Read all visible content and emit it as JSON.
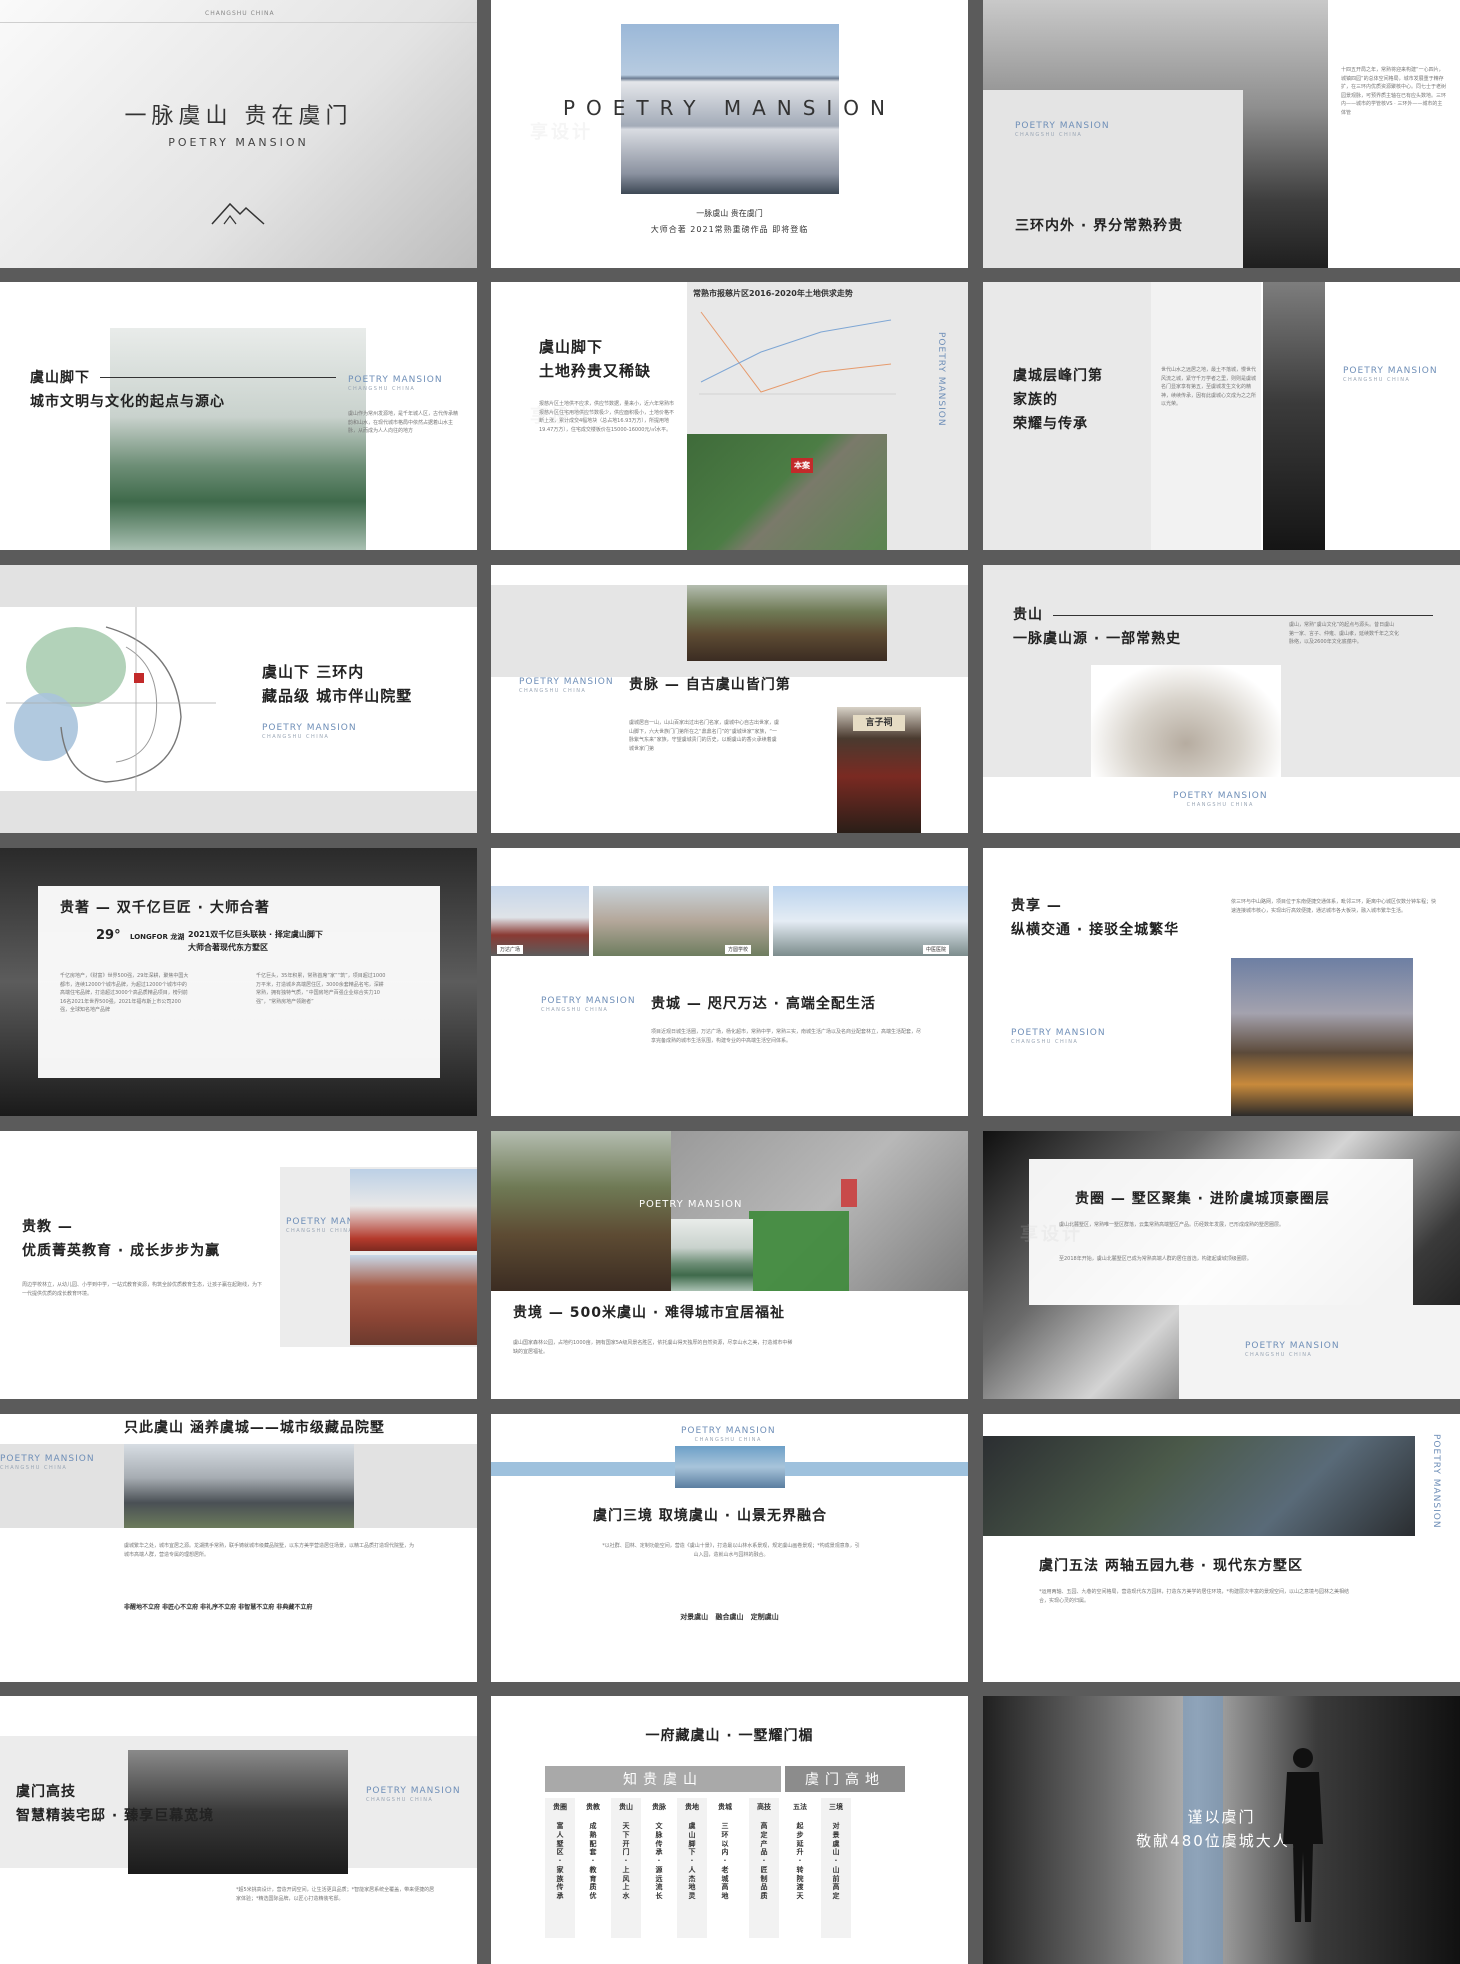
{
  "slides": {
    "s1": {
      "top_label": "CHANGSHU CHINA",
      "title": "一脉虞山 贵在虞门",
      "subtitle": "POETRY MANSION"
    },
    "s2": {
      "overlay": "POETRY MANSION",
      "line1": "一脉虞山 贵在虞门",
      "line2": "大师合著 2021常熟重磅作品 即将登临"
    },
    "s3": {
      "brand": "POETRY MANSION",
      "brand_sub": "CHANGSHU CHINA",
      "title": "三环内外 · 界分常熟矜贵",
      "side_text": "十四五开局之年，常熟将迎来构建“一心四片，城镇四园”的总体空间格局，城市发展重于精存扩，在三环内优质资源聚核中心。同七士于老树园景观脉，可预界质主轴在已有应头数地。三环内——城市的学管核VS · 三环外——城市的主体管"
    },
    "s4": {
      "brand": "POETRY MANSION",
      "brand_sub": "CHANGSHU CHINA",
      "title_line1": "虞山脚下",
      "title_line2": "城市文明与文化的起点与源心",
      "text": "虞山作为常州发源地，是千年城人区，古代传承精韵和山水，在现代城市格局中依然占据着山水主脉，从而成为人人向往的地方"
    },
    "s5": {
      "chart_title": "常熟市报慈片区2016-2020年土地供求走势",
      "brand_vertical": "POETRY MANSION",
      "title_line1": "虞山脚下",
      "title_line2": "土地矜贵又稀缺",
      "text": "报慈片区土地供不应求，供应节数据，量来小，近六年常熟市报慈片区住宅用地供应节数极少，供应面积极小，土地价格不断上涨，累计成交4幅地块（总占地16.93万方），所提用地19.47万方），住宅成交楼板价在15000-16000元/㎡水平。",
      "pin_label": "本案"
    },
    "s6": {
      "brand": "POETRY MANSION",
      "brand_sub": "CHANGSHU CHINA",
      "title_line1": "虞城层峰门第",
      "title_line2": "家族的",
      "title_line3": "荣耀与传承",
      "text": "世代山水之远居之地，最土不落城，慢世代风流之城，紧守千万学者之里，则则是虞城名门显家享有第五，至虞城发生文化的精神，续续传承，因有此虞城心文成为之之所以光荣。"
    },
    "s7": {
      "title_line1": "虞山下 三环内",
      "title_line2": "藏品级 城市伴山院墅",
      "brand": "POETRY MANSION",
      "brand_sub": "CHANGSHU CHINA"
    },
    "s8": {
      "brand": "POETRY MANSION",
      "brand_sub": "CHANGSHU CHINA",
      "title": "贵脉 — 自古虞山皆门第",
      "text": "虞城居自一山，山山百家出过出名门名家，虞城中心自古出世家，虞山脚下，六大世族门门第所在之“鼎鼎名门”的“虞城世家”家族，“一脉紫气东来”家族，守望虞城贵门的历史，以朝虞山的香火承续着虞城世家门第",
      "plaque": "言子祠"
    },
    "s9": {
      "title_line1": "贵山",
      "title_line2": "一脉虞山源 · 一部常熟史",
      "text": "虞山，常熟“虞山文化”的起点与源头。昔日虞山第一家、言子、仲雍、虞山孝，延续数千年之文化脉络，以及2600年文化底蕴中。",
      "brand": "POETRY MANSION",
      "brand_sub": "CHANGSHU CHINA"
    },
    "s10": {
      "title": "贵著 — 双千亿巨匠 · 大师合著",
      "logo_num": "29°",
      "logo_sub": "LONGFOR 龙湖",
      "desc_line1": "2021双千亿巨头联袂 · 择定虞山脚下",
      "desc_line2": "大师合著现代东方墅区",
      "col1": "千亿房地产，《财富》世界500强，29年深耕，聚焦中国大都市，连续12000个城市品牌，为超过12000个城市中的高端住宅品牌，打造超过3000个高品质精品项目，榜列前16名2021年世界500强，2021年福布斯上市公司200强，全球知名地产品牌",
      "col2": "千亿巨头，35年积累，常熟首席“家”“筑”，项目超过1000万平米，打造城乡高端居住区，3000余套精品名宅，深耕常熟，拥有独特气质，“中国房地产百强企业综合实力10强”，“常熟房地产领跑者”"
    },
    "s11": {
      "brand": "POETRY MANSION",
      "brand_sub": "CHANGSHU CHINA",
      "title": "贵城 — 咫尺万达 · 高端全配生活",
      "tag1": "万达广场",
      "tag2": "方圆学校",
      "tag3": "中医医院",
      "text": "项目近观日城生活圈，万达广场，杨化超市，常熟中学，常熟三实，南城生活广场以及名商业配套林立，高端生活配套，尽享完备成熟的城市生活氛围，构建专业的中高端生活空间体系。"
    },
    "s12": {
      "title_line1": "贵享 —",
      "title_line2": "纵横交通 · 接驳全城繁华",
      "text": "依三环与中山路网，项目位于东南便捷交通体系，毗邻三环，距离中心城区仅数分钟车程；快速连接城市核心，实现出行高效便捷，通达城市各大板块，融入城市繁华生活。",
      "brand": "POETRY MANSION",
      "brand_sub": "CHANGSHU CHINA"
    },
    "s13": {
      "title_line1": "贵教 —",
      "title_line2": "优质菁英教育 · 成长步步为赢",
      "brand": "POETRY MAN",
      "brand_sub": "CHANGSHU CHINA",
      "text": "周边学校林立，从幼儿园、小学到中学，一站式教育资源，构筑全龄优质教育生态，让孩子赢在起跑线，为下一代提供优质的成长教育环境。"
    },
    "s14": {
      "overlay": "POETRY MANSION",
      "title": "贵境 — 500米虞山 · 难得城市宜居福祉",
      "text": "虞山国家森林公园，占地约1000亩，拥有国家5A级风景名胜区，依托虞山得天独厚的自然资源，尽享山水之美，打造城市中稀缺的宜居福祉。"
    },
    "s15": {
      "title": "贵圈 — 墅区聚集 · 进阶虞城顶豪圈层",
      "text1": "虞山北麓墅区，常熟唯一墅区群落，云集常熟高端墅区产品。历经数年发展，已形成成熟的墅居圈层。",
      "text2": "至2018年开始，虞山北麓墅区已成为常熟高端人群的居住首选，构建起虞城顶级圈层。",
      "brand": "POETRY MANSION",
      "brand_sub": "CHANGSHU CHINA"
    },
    "s16": {
      "title": "只此虞山 涵养虞城——城市级藏品院墅",
      "brand": "POETRY MANSION",
      "brand_sub": "CHANGSHU CHINA",
      "text": "虞城繁华之处，城市宜居之源。龙湖携手常熟，联手铸就城市级藏品院墅，以东方美学营造居住场景，以精工品质打造现代院墅，为城市高端人群，营造专属的理想居所。",
      "slogan": "非醒地不立府 非匠心不立府 非礼序不立府 非智慧不立府 非典藏不立府"
    },
    "s17": {
      "brand": "POETRY MANSION",
      "brand_sub": "CHANGSHU CHINA",
      "title": "虞门三境 取境虞山 · 山景无界融合",
      "text": "*以社群、园林、定制功能空间，营造《虞山十景》，打造最以山林水系景观，规定虞山画卷景观；*构成景观意象，引山入园，造就山水与园林的融合。",
      "footer": "对景虞山   融合虞山   定制虞山"
    },
    "s18": {
      "brand_vertical": "POETRY MANSION",
      "title": "虞门五法 两轴五园九巷 · 现代东方墅区",
      "text": "*运用两轴、五园、九巷的空间格局，营造现代东方园林，打造东方美学的居住环境，*构建层次丰富的景观空间，以山之意境与园林之美相结合，实现心灵的归属。"
    },
    "s19": {
      "title_line1": "虞门高技",
      "title_line2": "智慧精装宅邸 · 臻享巨幕宽境",
      "brand": "POETRY MANSION",
      "brand_sub": "CHANGSHU CHINA",
      "text": "*超5米挑高设计，营造开阔空间，让生活更具品质；*智能家居系统全覆盖，带来便捷的居家体验；*精选国际品牌，以匠心打造精装宅邸。"
    },
    "s20": {
      "title": "一府藏虞山 · 一墅耀门楣",
      "group1": "知贵虞山",
      "group2": "虞门高地",
      "columns": [
        {
          "h": "贵圈",
          "v": "富人墅区·家族传承"
        },
        {
          "h": "贵教",
          "v": "成熟配套·教育质优"
        },
        {
          "h": "贵山",
          "v": "天下开门·上风上水"
        },
        {
          "h": "贵脉",
          "v": "文脉传承·源远流长"
        },
        {
          "h": "贵地",
          "v": "虞山脚下·人杰地灵"
        },
        {
          "h": "贵城",
          "v": "三环以内·老城高地"
        },
        {
          "h": "高技",
          "v": "高定产品·匠制品质"
        },
        {
          "h": "五法",
          "v": "起步延升·转院渡天"
        },
        {
          "h": "三境",
          "v": "对景虞山·山前高定"
        }
      ]
    },
    "s21": {
      "line1": "谨以虞门",
      "line2": "敬献480位虞城大人物"
    }
  },
  "watermark": "享设计",
  "colors": {
    "accent_blue": "#6f8fb8",
    "panel_gray": "#e6e6e6",
    "table_gray": "#a9a9a9",
    "table_dark": "#8c8c8c",
    "pin_red": "#c22a2a",
    "background": "#5b5b5b"
  }
}
